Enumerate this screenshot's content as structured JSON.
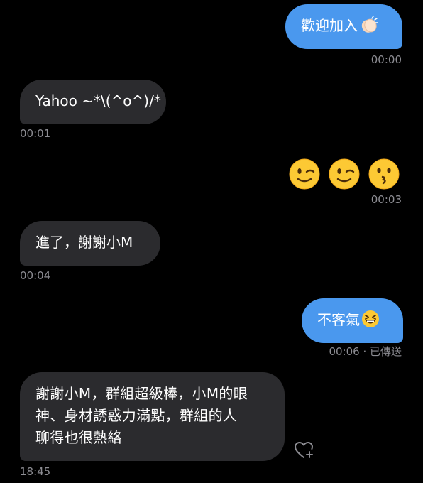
{
  "messages": [
    {
      "text": "歡迎加入",
      "emoji": "clapping-hands-emoji",
      "time": "00:00"
    },
    {
      "text": "Yahoo ~*\\(^o^)/*",
      "time": "00:01"
    },
    {
      "emojis": [
        "winking-face-emoji",
        "winking-face-emoji",
        "kissing-face-emoji"
      ],
      "time": "00:03"
    },
    {
      "text": "進了，謝謝小M",
      "time": "00:04"
    },
    {
      "text": "不客氣",
      "emoji": "grinning-squinting-face-emoji",
      "time": "00:06",
      "status": "· 已傳送"
    },
    {
      "lines": [
        "謝謝小M，群組超級棒，小M的眼",
        "神、身材誘惑力滿點，群組的人",
        "聊得也很熱絡"
      ],
      "time": "18:45"
    }
  ],
  "colors": {
    "background": "#000000",
    "outgoing_bubble": "#4a98ee",
    "incoming_bubble": "#2b2b2e",
    "timestamp": "#8d8d93",
    "text": "#ffffff"
  },
  "icons": {
    "react": "heart-plus-icon"
  }
}
